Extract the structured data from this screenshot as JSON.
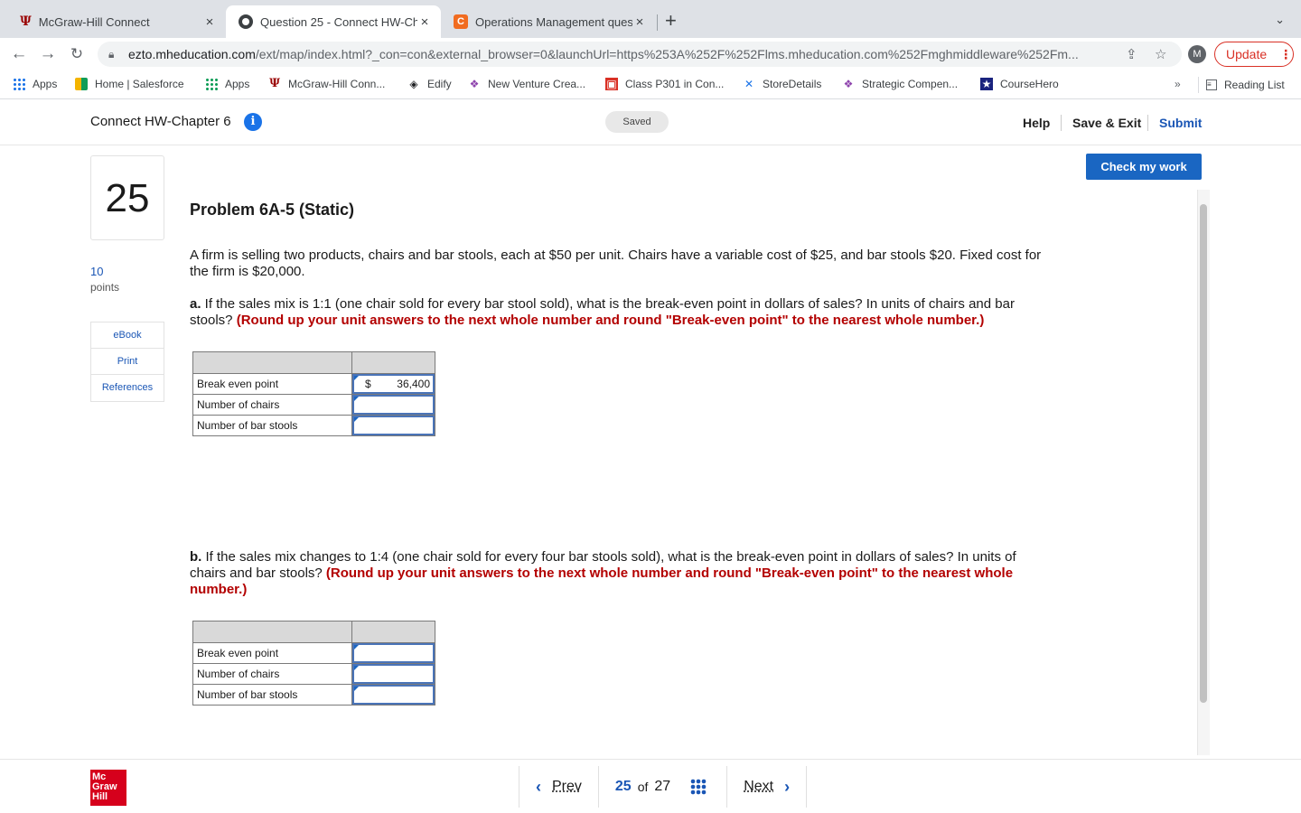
{
  "browser": {
    "tabs": [
      {
        "title": "McGraw-Hill Connect",
        "close": "×"
      },
      {
        "title": "Question 25 - Connect HW-Ch",
        "close": "×"
      },
      {
        "title": "Operations Management quest",
        "close": "×"
      }
    ],
    "new_tab": "+",
    "tab_menu": "⌄",
    "url_host": "ezto.mheducation.com",
    "url_path": "/ext/map/index.html?_con=con&external_browser=0&launchUrl=https%253A%252F%252Flms.mheducation.com%252Fmghmiddleware%252Fm...",
    "profile_initial": "M",
    "update_label": "Update",
    "bookmarks": [
      {
        "label": "Apps"
      },
      {
        "label": "Home | Salesforce"
      },
      {
        "label": "Apps"
      },
      {
        "label": "McGraw-Hill Conn..."
      },
      {
        "label": "Edify"
      },
      {
        "label": "New Venture Crea..."
      },
      {
        "label": "Class P301 in Con..."
      },
      {
        "label": "StoreDetails"
      },
      {
        "label": "Strategic Compen..."
      },
      {
        "label": "CourseHero"
      }
    ],
    "more_bookmarks": "»",
    "reading_list": "Reading List"
  },
  "header": {
    "assignment_title": "Connect HW-Chapter 6",
    "info": "i",
    "saved": "Saved",
    "help": "Help",
    "save_exit": "Save & Exit",
    "submit": "Submit"
  },
  "sidebar": {
    "question_number": "25",
    "points_value": "10",
    "points_label": "points",
    "tools": [
      "eBook",
      "Print",
      "References"
    ]
  },
  "main": {
    "check_label": "Check my work",
    "problem_title": "Problem 6A-5 (Static)",
    "intro": "A firm is selling two products, chairs and bar stools, each at $50 per unit. Chairs have a variable cost of $25, and bar stools $20. Fixed cost for the firm is $20,000.",
    "part_a": {
      "prefix": "a.",
      "question": " If the sales mix is 1:1 (one chair sold for every bar stool sold), what is the break-even point in dollars of sales? In units of chairs and bar stools? ",
      "instruction": "(Round up your unit answers to the next whole number and round \"Break-even point\" to the nearest whole number.)",
      "rows": [
        {
          "label": "Break even point",
          "currency": "$",
          "value": "36,400"
        },
        {
          "label": "Number of chairs",
          "currency": "",
          "value": ""
        },
        {
          "label": "Number of bar stools",
          "currency": "",
          "value": ""
        }
      ]
    },
    "part_b": {
      "prefix": "b.",
      "question": " If the sales mix changes to 1:4 (one chair sold for every four bar stools sold), what is the break-even point in dollars of sales? In units of chairs and bar stools? ",
      "instruction": "(Round up your unit answers to the next whole number and round \"Break-even point\" to the nearest whole number.)",
      "rows": [
        {
          "label": "Break even point",
          "currency": "",
          "value": ""
        },
        {
          "label": "Number of chairs",
          "currency": "",
          "value": ""
        },
        {
          "label": "Number of bar stools",
          "currency": "",
          "value": ""
        }
      ]
    }
  },
  "footer": {
    "logo": [
      "Mc",
      "Graw",
      "Hill"
    ],
    "prev": "Prev",
    "current": "25",
    "of": "of",
    "total": "27",
    "next": "Next"
  }
}
